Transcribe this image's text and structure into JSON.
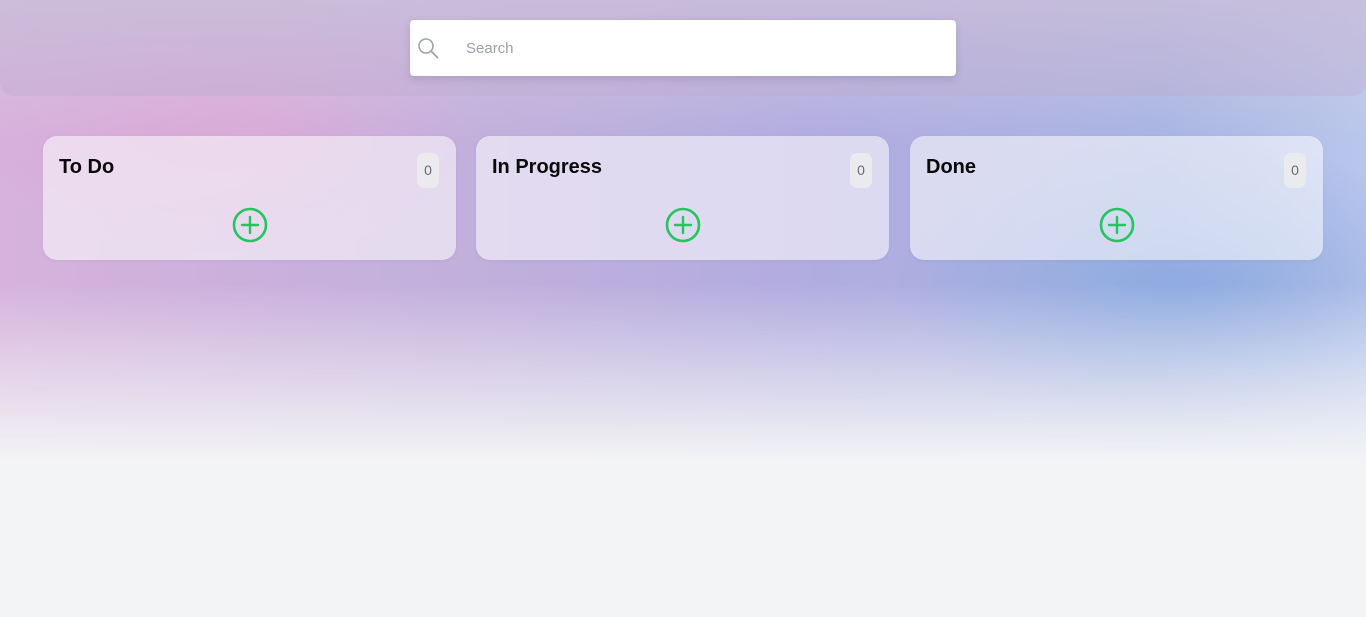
{
  "search": {
    "placeholder": "Search",
    "icon": "search-icon"
  },
  "columns": [
    {
      "title": "To Do",
      "count": "0",
      "add_icon": "plus-circle-icon"
    },
    {
      "title": "In Progress",
      "count": "0",
      "add_icon": "plus-circle-icon"
    },
    {
      "title": "Done",
      "count": "0",
      "add_icon": "plus-circle-icon"
    }
  ],
  "colors": {
    "accent_green": "#22c55e",
    "page_background": "#f3f4f6",
    "card_background": "rgba(255,255,255,0.55)",
    "badge_background": "#ebebee"
  }
}
